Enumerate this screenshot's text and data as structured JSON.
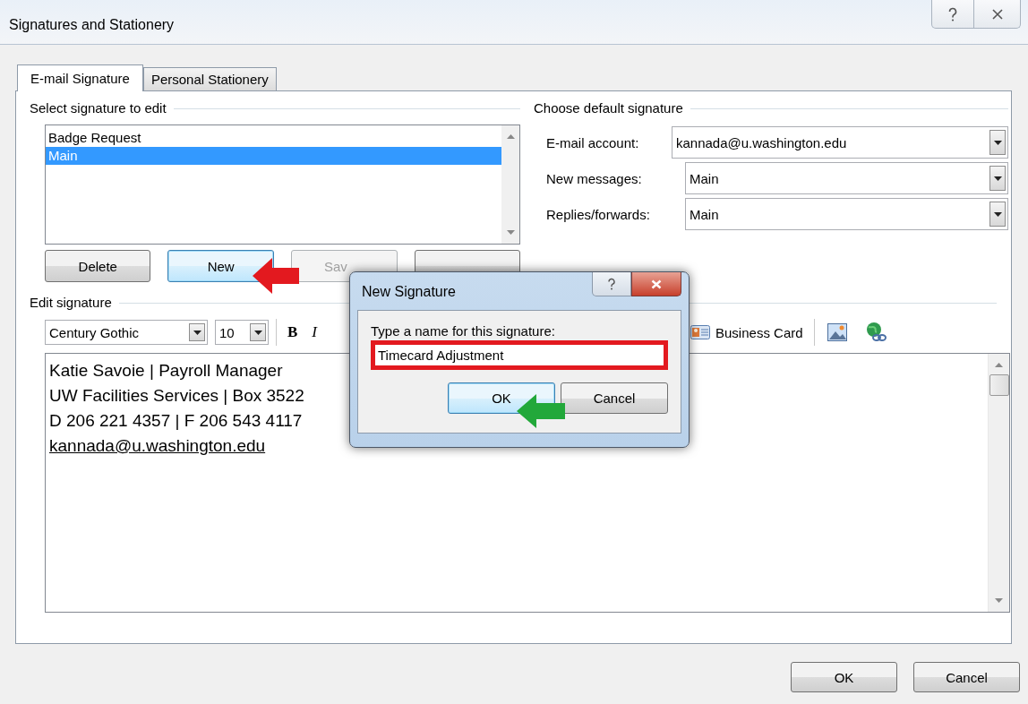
{
  "window": {
    "title": "Signatures and Stationery"
  },
  "tabs": [
    {
      "label": "E-mail Signature",
      "selected": true
    },
    {
      "label": "Personal Stationery",
      "selected": false
    }
  ],
  "select_group": {
    "title": "Select signature to edit",
    "signatures": [
      {
        "label": "Badge Request",
        "selected": false
      },
      {
        "label": "Main",
        "selected": true
      }
    ],
    "buttons": [
      {
        "label": "Delete",
        "disabled": false,
        "focused": false
      },
      {
        "label": "New",
        "disabled": false,
        "focused": true
      },
      {
        "label": "Sav",
        "disabled": true,
        "focused": false
      },
      {
        "disabled": false,
        "focused": false
      }
    ]
  },
  "default_group": {
    "title": "Choose default signature",
    "fields": [
      {
        "label": "E-mail account:",
        "value": "kannada@u.washington.edu"
      },
      {
        "label": "New messages:",
        "value": "Main"
      },
      {
        "label": "Replies/forwards:",
        "value": "Main"
      }
    ]
  },
  "edit_group": {
    "title": "Edit signature",
    "font": "Century Gothic",
    "size": "10",
    "format_buttons": [
      {
        "label": "B",
        "kind": "bold"
      },
      {
        "label": "I",
        "kind": "italic"
      }
    ],
    "business_card": "Business Card",
    "lines": [
      {
        "text": "Katie Savoie | Payroll Manager",
        "kind": "text"
      },
      {
        "text": "UW Facilities Services | Box 3522",
        "kind": "text"
      },
      {
        "text": "D 206 221 4357 | F 206 543 4117",
        "kind": "text"
      },
      {
        "text": "kannada@u.washington.edu",
        "kind": "link"
      }
    ]
  },
  "footer_buttons": [
    "OK",
    "Cancel"
  ],
  "dialog": {
    "title": "New Signature",
    "prompt": "Type a name for this signature:",
    "value": "Timecard Adjustment",
    "buttons": [
      {
        "label": "OK",
        "default": true
      },
      {
        "label": "Cancel",
        "default": false
      }
    ]
  }
}
